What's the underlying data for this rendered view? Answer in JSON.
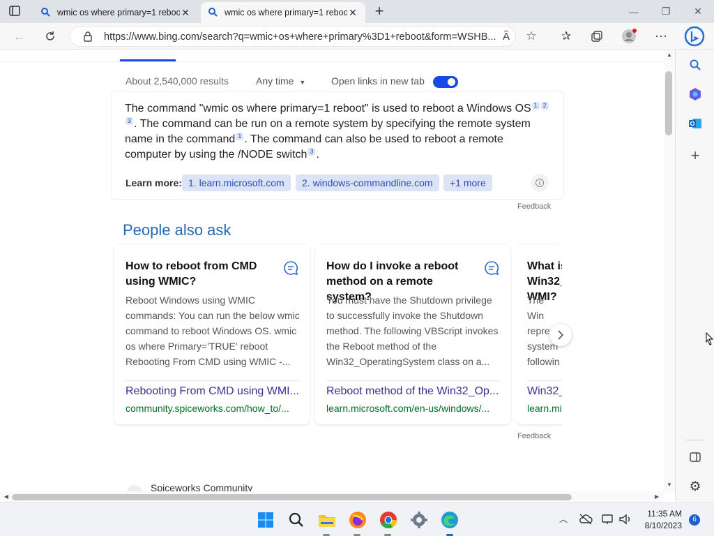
{
  "browser": {
    "tabs": [
      {
        "title": "wmic os where primary=1 reboot",
        "active": false
      },
      {
        "title": "wmic os where primary=1 reboot",
        "active": true
      }
    ],
    "new_tab": "+",
    "url": "https://www.bing.com/search?q=wmic+os+where+primary%3D1+reboot&form=WSHB..."
  },
  "toolbar": {
    "results_count": "About 2,540,000 results",
    "time_filter": "Any time",
    "open_links_label": "Open links in new tab",
    "open_links_enabled": true
  },
  "answer": {
    "segments": [
      {
        "text": "The command \"wmic os where primary=1 reboot\" is used to reboot a Windows OS",
        "cites": [
          "1",
          "2",
          "3"
        ]
      },
      {
        "text": ". The command can be run on a remote system by specifying the remote system name in the command",
        "cites": [
          "1"
        ]
      },
      {
        "text": ". The command can also be used to reboot a remote computer by using the /NODE switch",
        "cites": [
          "3"
        ]
      },
      {
        "text": ".",
        "cites": []
      }
    ],
    "learn_more_label": "Learn more:",
    "learn_more_links": [
      "1. learn.microsoft.com",
      "2. windows-commandline.com",
      "+1 more"
    ],
    "feedback": "Feedback"
  },
  "people_also_ask": {
    "heading": "People also ask",
    "cards": [
      {
        "question": "How to reboot from CMD using WMIC?",
        "body": "Reboot Windows using WMIC commands: You can run the below wmic command to reboot Windows OS. wmic os where Primary='TRUE' reboot Rebooting From CMD using WMIC -...",
        "link": "Rebooting From CMD using WMI...",
        "url": "community.spiceworks.com/how_to/..."
      },
      {
        "question": "How do I invoke a reboot method on a remote system?",
        "body": "You must have the Shutdown privilege to successfully invoke the Shutdown method. The following VBScript invokes the Reboot method of the Win32_OperatingSystem class on a...",
        "link": "Reboot method of the Win32_Op...",
        "url": "learn.microsoft.com/en-us/windows/..."
      },
      {
        "question": "What is Win32_ WMI?",
        "body": "The Win repre system followin",
        "link": "Win32_",
        "url": "learn.mi"
      }
    ],
    "feedback": "Feedback"
  },
  "next_result": {
    "site": "Spiceworks Community"
  },
  "taskbar": {
    "time": "11:35 AM",
    "date": "8/10/2023",
    "notification_count": "6"
  }
}
